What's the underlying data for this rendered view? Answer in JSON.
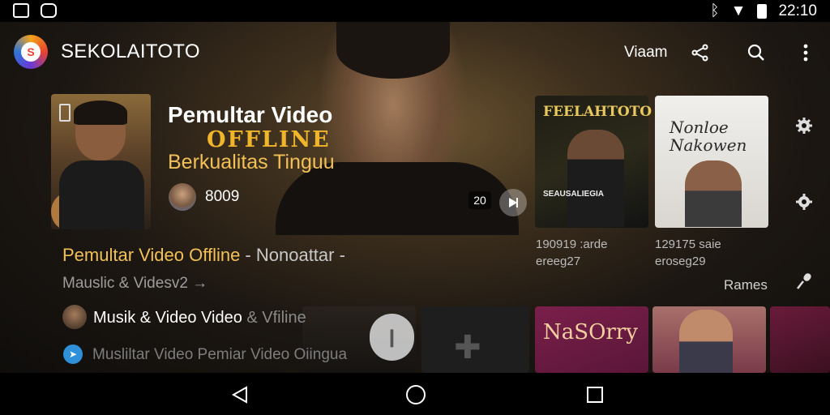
{
  "status_bar": {
    "time": "22:10",
    "left_icons": [
      "notification-n-icon",
      "notification-app-icon"
    ],
    "right_icons": [
      "vibrate-icon",
      "wifi-icon",
      "battery-icon"
    ]
  },
  "app_bar": {
    "title": "SEKOLAITOTO",
    "view_label": "Viaam",
    "icons": [
      "share-icon",
      "search-icon",
      "more-vert-icon"
    ]
  },
  "featured": {
    "title": "Pemultar Video",
    "highlight": "OFFLINE",
    "subtitle": "Berkualitas Tinguu",
    "count": "8009",
    "duration_badge": "20"
  },
  "side_cards": [
    {
      "title": "FEELAHTOTO",
      "tag": "SEAUSALIEGIA",
      "meta_line1": "190919 :arde",
      "meta_line2": "ereeg27"
    },
    {
      "title": "Nonloe Nakowen",
      "meta_line1": "129175 saie",
      "meta_line2": "eroseg29"
    }
  ],
  "rail_icons": [
    "gear-icon",
    "settings-alt-icon",
    "microphone-icon"
  ],
  "section": {
    "title": "Pemultar Video Offline",
    "title_suffix": " - Nonoattar -",
    "subtitle": "Mauslic & Videsv2 →",
    "right_label": "Rames"
  },
  "list_items": [
    {
      "main": "Musik & Video Video ",
      "faded": "& Vfiline"
    },
    {
      "main": "Musliltar Video Pemiar Video Oiingua"
    }
  ],
  "bottom_cards": [
    {
      "title": "NaSOrry"
    }
  ],
  "nav_bar": {
    "icons": [
      "back-icon",
      "home-icon",
      "recents-icon"
    ]
  },
  "colors": {
    "accent": "#f2c057",
    "offline_gold": "#f0b52a"
  }
}
